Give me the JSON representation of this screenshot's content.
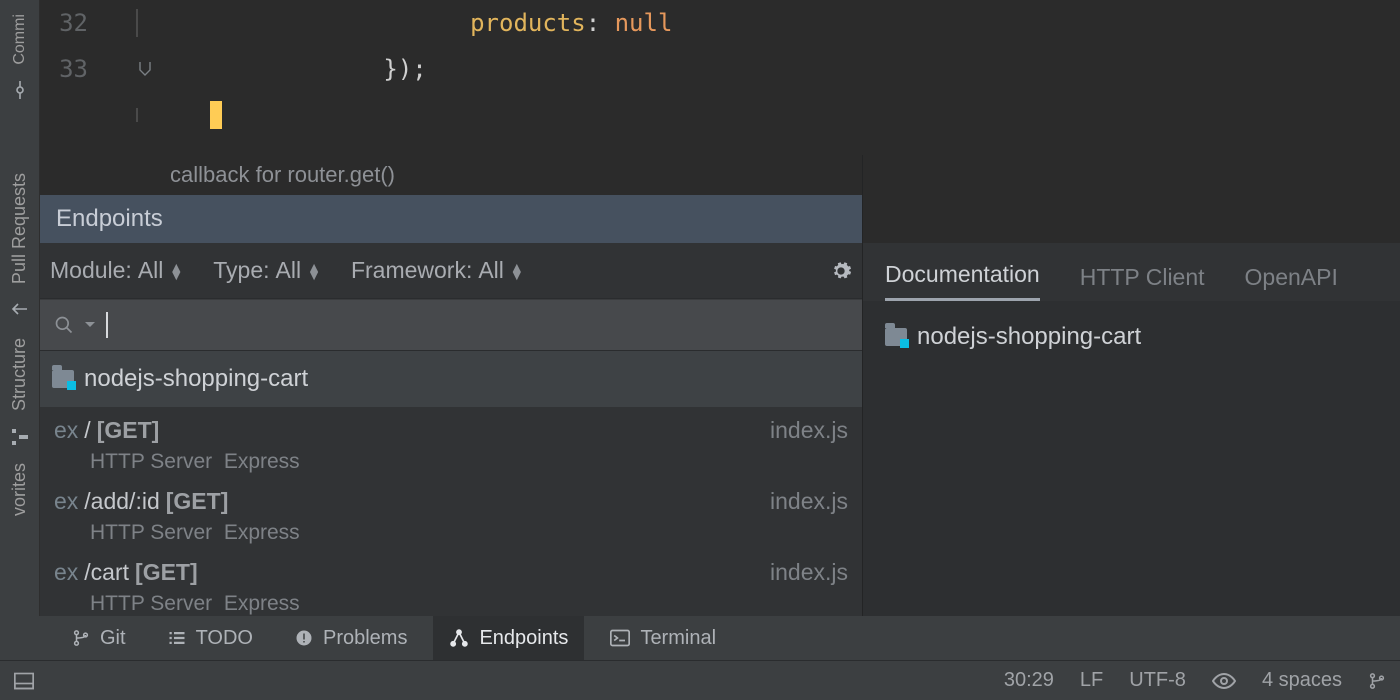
{
  "leftStrip": {
    "top_label": "Commi",
    "labels": [
      "Pull Requests",
      "Structure",
      "vorites"
    ]
  },
  "editor": {
    "hint": "callback for router.get()",
    "lines": [
      {
        "num": "32",
        "indent": "                  ",
        "tokens": [
          {
            "cls": "tok-key",
            "text": "products"
          },
          {
            "cls": "tok-pun",
            "text": ": "
          },
          {
            "cls": "tok-null",
            "text": "null"
          }
        ]
      },
      {
        "num": "33",
        "indent": "            ",
        "tokens": [
          {
            "cls": "tok-pun",
            "text": "});"
          }
        ]
      }
    ]
  },
  "tool": {
    "title": "Endpoints",
    "filters": {
      "module_label": "Module:",
      "module_value": "All",
      "type_label": "Type:",
      "type_value": "All",
      "fw_label": "Framework:",
      "fw_value": "All"
    },
    "project": "nodejs-shopping-cart",
    "endpoints": [
      {
        "route": "/",
        "method": "[GET]",
        "file": "index.js",
        "server": "HTTP Server",
        "framework": "Express"
      },
      {
        "route": "/add/:id",
        "method": "[GET]",
        "file": "index.js",
        "server": "HTTP Server",
        "framework": "Express"
      },
      {
        "route": "/cart",
        "method": "[GET]",
        "file": "index.js",
        "server": "HTTP Server",
        "framework": "Express"
      }
    ]
  },
  "right": {
    "tabs": [
      "Documentation",
      "HTTP Client",
      "OpenAPI"
    ],
    "active_tab": 0,
    "project": "nodejs-shopping-cart"
  },
  "bottom_tabs": [
    {
      "icon": "branch",
      "label": "Git"
    },
    {
      "icon": "list",
      "label": "TODO"
    },
    {
      "icon": "warn",
      "label": "Problems"
    },
    {
      "icon": "graph",
      "label": "Endpoints",
      "active": true
    },
    {
      "icon": "term",
      "label": "Terminal"
    }
  ],
  "status": {
    "caret": "30:29",
    "eol": "LF",
    "enc": "UTF-8",
    "indent": "4 spaces"
  }
}
